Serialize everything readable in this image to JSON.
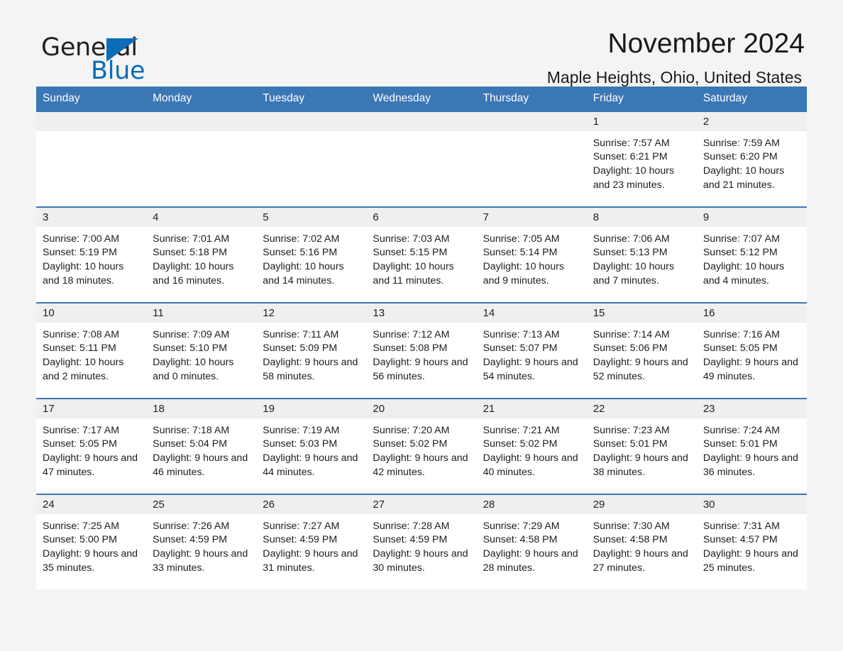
{
  "brand": {
    "name_part1": "General",
    "name_part2": "Blue",
    "triangle_icon": "triangle-icon",
    "accent_color": "#0b6cb7"
  },
  "header": {
    "title": "November 2024",
    "subtitle": "Maple Heights, Ohio, United States"
  },
  "colors": {
    "header_blue": "#3a77b5",
    "day_band_gray": "#efefef",
    "page_background": "#f4f4f4",
    "text": "#1c1c1c"
  },
  "weekdays": [
    "Sunday",
    "Monday",
    "Tuesday",
    "Wednesday",
    "Thursday",
    "Friday",
    "Saturday"
  ],
  "labels": {
    "sunrise_prefix": "Sunrise:",
    "sunset_prefix": "Sunset:",
    "daylight_prefix": "Daylight:"
  },
  "weeks": [
    [
      {
        "day": "",
        "empty": true
      },
      {
        "day": "",
        "empty": true
      },
      {
        "day": "",
        "empty": true
      },
      {
        "day": "",
        "empty": true
      },
      {
        "day": "",
        "empty": true
      },
      {
        "day": "1",
        "sunrise": "Sunrise: 7:57 AM",
        "sunset": "Sunset: 6:21 PM",
        "daylight": "Daylight: 10 hours and 23 minutes."
      },
      {
        "day": "2",
        "sunrise": "Sunrise: 7:59 AM",
        "sunset": "Sunset: 6:20 PM",
        "daylight": "Daylight: 10 hours and 21 minutes."
      }
    ],
    [
      {
        "day": "3",
        "sunrise": "Sunrise: 7:00 AM",
        "sunset": "Sunset: 5:19 PM",
        "daylight": "Daylight: 10 hours and 18 minutes."
      },
      {
        "day": "4",
        "sunrise": "Sunrise: 7:01 AM",
        "sunset": "Sunset: 5:18 PM",
        "daylight": "Daylight: 10 hours and 16 minutes."
      },
      {
        "day": "5",
        "sunrise": "Sunrise: 7:02 AM",
        "sunset": "Sunset: 5:16 PM",
        "daylight": "Daylight: 10 hours and 14 minutes."
      },
      {
        "day": "6",
        "sunrise": "Sunrise: 7:03 AM",
        "sunset": "Sunset: 5:15 PM",
        "daylight": "Daylight: 10 hours and 11 minutes."
      },
      {
        "day": "7",
        "sunrise": "Sunrise: 7:05 AM",
        "sunset": "Sunset: 5:14 PM",
        "daylight": "Daylight: 10 hours and 9 minutes."
      },
      {
        "day": "8",
        "sunrise": "Sunrise: 7:06 AM",
        "sunset": "Sunset: 5:13 PM",
        "daylight": "Daylight: 10 hours and 7 minutes."
      },
      {
        "day": "9",
        "sunrise": "Sunrise: 7:07 AM",
        "sunset": "Sunset: 5:12 PM",
        "daylight": "Daylight: 10 hours and 4 minutes."
      }
    ],
    [
      {
        "day": "10",
        "sunrise": "Sunrise: 7:08 AM",
        "sunset": "Sunset: 5:11 PM",
        "daylight": "Daylight: 10 hours and 2 minutes."
      },
      {
        "day": "11",
        "sunrise": "Sunrise: 7:09 AM",
        "sunset": "Sunset: 5:10 PM",
        "daylight": "Daylight: 10 hours and 0 minutes."
      },
      {
        "day": "12",
        "sunrise": "Sunrise: 7:11 AM",
        "sunset": "Sunset: 5:09 PM",
        "daylight": "Daylight: 9 hours and 58 minutes."
      },
      {
        "day": "13",
        "sunrise": "Sunrise: 7:12 AM",
        "sunset": "Sunset: 5:08 PM",
        "daylight": "Daylight: 9 hours and 56 minutes."
      },
      {
        "day": "14",
        "sunrise": "Sunrise: 7:13 AM",
        "sunset": "Sunset: 5:07 PM",
        "daylight": "Daylight: 9 hours and 54 minutes."
      },
      {
        "day": "15",
        "sunrise": "Sunrise: 7:14 AM",
        "sunset": "Sunset: 5:06 PM",
        "daylight": "Daylight: 9 hours and 52 minutes."
      },
      {
        "day": "16",
        "sunrise": "Sunrise: 7:16 AM",
        "sunset": "Sunset: 5:05 PM",
        "daylight": "Daylight: 9 hours and 49 minutes."
      }
    ],
    [
      {
        "day": "17",
        "sunrise": "Sunrise: 7:17 AM",
        "sunset": "Sunset: 5:05 PM",
        "daylight": "Daylight: 9 hours and 47 minutes."
      },
      {
        "day": "18",
        "sunrise": "Sunrise: 7:18 AM",
        "sunset": "Sunset: 5:04 PM",
        "daylight": "Daylight: 9 hours and 46 minutes."
      },
      {
        "day": "19",
        "sunrise": "Sunrise: 7:19 AM",
        "sunset": "Sunset: 5:03 PM",
        "daylight": "Daylight: 9 hours and 44 minutes."
      },
      {
        "day": "20",
        "sunrise": "Sunrise: 7:20 AM",
        "sunset": "Sunset: 5:02 PM",
        "daylight": "Daylight: 9 hours and 42 minutes."
      },
      {
        "day": "21",
        "sunrise": "Sunrise: 7:21 AM",
        "sunset": "Sunset: 5:02 PM",
        "daylight": "Daylight: 9 hours and 40 minutes."
      },
      {
        "day": "22",
        "sunrise": "Sunrise: 7:23 AM",
        "sunset": "Sunset: 5:01 PM",
        "daylight": "Daylight: 9 hours and 38 minutes."
      },
      {
        "day": "23",
        "sunrise": "Sunrise: 7:24 AM",
        "sunset": "Sunset: 5:01 PM",
        "daylight": "Daylight: 9 hours and 36 minutes."
      }
    ],
    [
      {
        "day": "24",
        "sunrise": "Sunrise: 7:25 AM",
        "sunset": "Sunset: 5:00 PM",
        "daylight": "Daylight: 9 hours and 35 minutes."
      },
      {
        "day": "25",
        "sunrise": "Sunrise: 7:26 AM",
        "sunset": "Sunset: 4:59 PM",
        "daylight": "Daylight: 9 hours and 33 minutes."
      },
      {
        "day": "26",
        "sunrise": "Sunrise: 7:27 AM",
        "sunset": "Sunset: 4:59 PM",
        "daylight": "Daylight: 9 hours and 31 minutes."
      },
      {
        "day": "27",
        "sunrise": "Sunrise: 7:28 AM",
        "sunset": "Sunset: 4:59 PM",
        "daylight": "Daylight: 9 hours and 30 minutes."
      },
      {
        "day": "28",
        "sunrise": "Sunrise: 7:29 AM",
        "sunset": "Sunset: 4:58 PM",
        "daylight": "Daylight: 9 hours and 28 minutes."
      },
      {
        "day": "29",
        "sunrise": "Sunrise: 7:30 AM",
        "sunset": "Sunset: 4:58 PM",
        "daylight": "Daylight: 9 hours and 27 minutes."
      },
      {
        "day": "30",
        "sunrise": "Sunrise: 7:31 AM",
        "sunset": "Sunset: 4:57 PM",
        "daylight": "Daylight: 9 hours and 25 minutes."
      }
    ]
  ]
}
